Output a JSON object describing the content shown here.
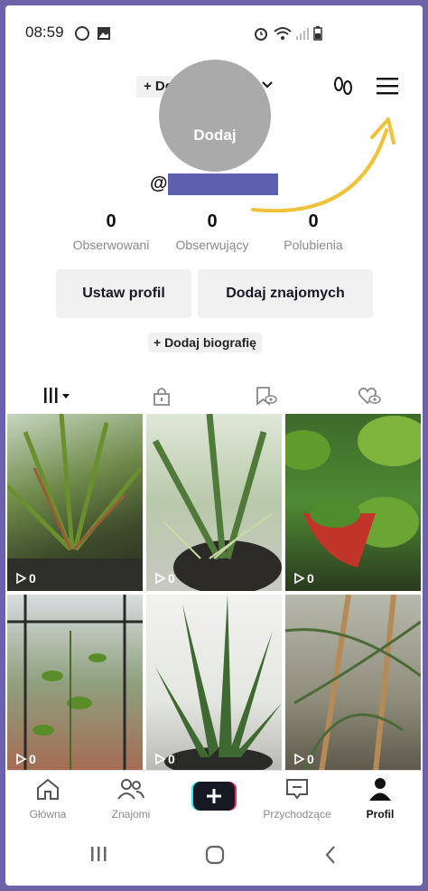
{
  "status": {
    "time": "08:59"
  },
  "header": {
    "add_name": "+ Dodaj nazwę"
  },
  "profile": {
    "avatar_label": "Dodaj",
    "handle_prefix": "@",
    "stats": [
      {
        "value": "0",
        "label": "Obserwowani"
      },
      {
        "value": "0",
        "label": "Obserwujący"
      },
      {
        "value": "0",
        "label": "Polubienia"
      }
    ],
    "setup_button": "Ustaw profil",
    "add_friends_button": "Dodaj znajomych",
    "bio_button": "+ Dodaj biografię"
  },
  "videos": [
    {
      "views": "0"
    },
    {
      "views": "0"
    },
    {
      "views": "0"
    },
    {
      "views": "0"
    },
    {
      "views": "0"
    },
    {
      "views": "0"
    }
  ],
  "bottom_nav": {
    "home": "Główna",
    "friends": "Znajomi",
    "inbox": "Przychodzące",
    "profile": "Profil"
  },
  "colors": {
    "accent_arrow": "#f0c23a",
    "handle_redaction": "#5d5fb0"
  }
}
